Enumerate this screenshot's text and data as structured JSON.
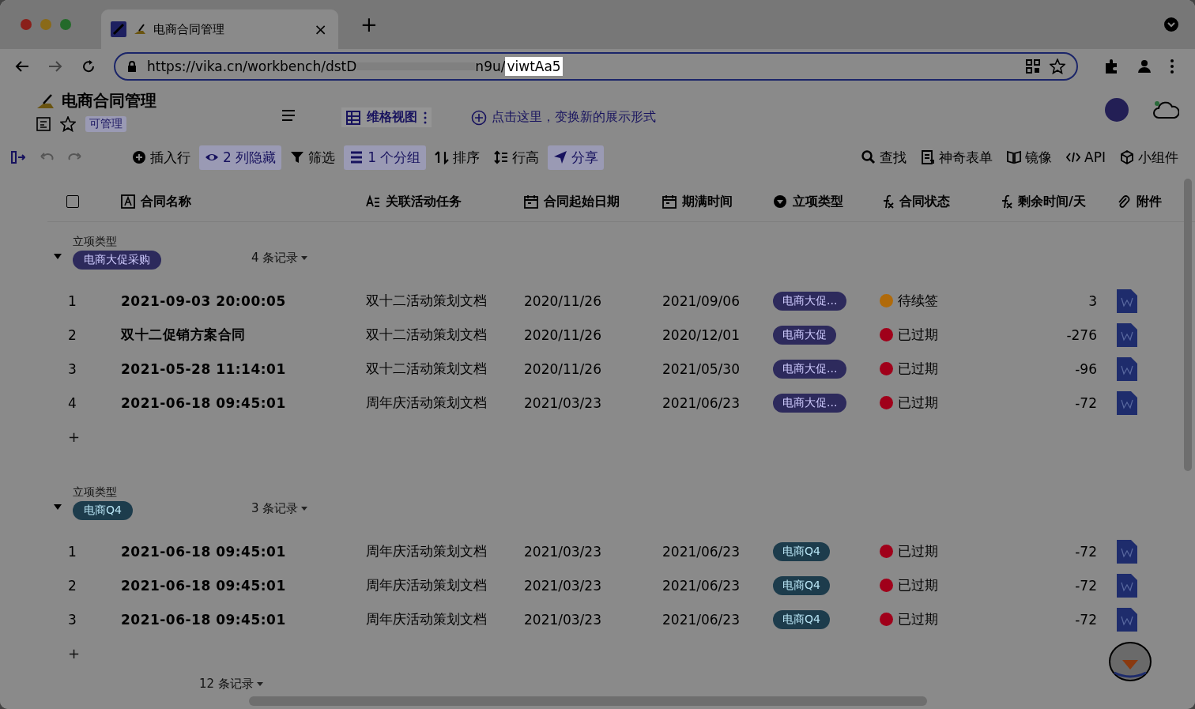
{
  "browser": {
    "tab": {
      "title": "电商合同管理",
      "close": "×"
    },
    "new_tab": "+",
    "url": {
      "prefix": "https://vika.cn/workbench/dstD",
      "middle": "n9u/",
      "selected": "viwtAa5"
    }
  },
  "header": {
    "title": "电商合同管理",
    "permission": "可管理",
    "view_tab": "维格视图",
    "add_view_hint": "点击这里，变换新的展示形式"
  },
  "toolbar": {
    "left": [
      {
        "label": "插入行",
        "accent": false
      },
      {
        "label": "2 列隐藏",
        "accent": true
      },
      {
        "label": "筛选",
        "accent": false
      },
      {
        "label": "1 个分组",
        "accent": true
      },
      {
        "label": "排序",
        "accent": false
      },
      {
        "label": "行高",
        "accent": false
      },
      {
        "label": "分享",
        "accent": true
      }
    ],
    "right": [
      {
        "label": "查找"
      },
      {
        "label": "神奇表单"
      },
      {
        "label": "镜像"
      },
      {
        "label": "API"
      },
      {
        "label": "小组件"
      }
    ]
  },
  "select_all": {
    "checked": false
  },
  "columns": [
    {
      "label": "合同名称"
    },
    {
      "label": "关联活动任务"
    },
    {
      "label": "合同起始日期"
    },
    {
      "label": "期满时间"
    },
    {
      "label": "立项类型"
    },
    {
      "label": "合同状态"
    },
    {
      "label": "剩余时间/天"
    },
    {
      "label": "附件"
    }
  ],
  "groups": [
    {
      "field": "立项类型",
      "tag": "电商大促采购",
      "color": "#2d2a5c",
      "count": "4 条记录",
      "add": "+",
      "rows": [
        {
          "number": "1",
          "name": "2021-09-03 20:00:05",
          "task": "双十二活动策划文档",
          "start": "2020/11/26",
          "end": "2021/09/06",
          "type": "电商大促...",
          "status": "待续签",
          "color": "#b06a0a",
          "remaining": "3"
        },
        {
          "number": "2",
          "name": "双十二促销方案合同",
          "task": "双十二活动策划文档",
          "start": "2020/11/26",
          "end": "2020/12/01",
          "type": "电商大促",
          "status": "已过期",
          "color": "#a0001a",
          "remaining": "-276"
        },
        {
          "number": "3",
          "name": "2021-05-28 11:14:01",
          "task": "双十二活动策划文档",
          "start": "2020/11/26",
          "end": "2021/05/30",
          "type": "电商大促...",
          "status": "已过期",
          "color": "#a0001a",
          "remaining": "-96"
        },
        {
          "number": "4",
          "name": "2021-06-18 09:45:01",
          "task": "周年庆活动策划文档",
          "start": "2021/03/23",
          "end": "2021/06/23",
          "type": "电商大促...",
          "status": "已过期",
          "color": "#a0001a",
          "remaining": "-72"
        }
      ]
    },
    {
      "field": "立项类型",
      "tag": "电商Q4",
      "color": "#1d3c4c",
      "count": "3 条记录",
      "add": "+",
      "rows": [
        {
          "number": "1",
          "name": "2021-06-18 09:45:01",
          "task": "周年庆活动策划文档",
          "start": "2021/03/23",
          "end": "2021/06/23",
          "type": "电商Q4",
          "status": "已过期",
          "color": "#a0001a",
          "remaining": "-72"
        },
        {
          "number": "2",
          "name": "2021-06-18 09:45:01",
          "task": "周年庆活动策划文档",
          "start": "2021/03/23",
          "end": "2021/06/23",
          "type": "电商Q4",
          "status": "已过期",
          "color": "#a0001a",
          "remaining": "-72"
        },
        {
          "number": "3",
          "name": "2021-06-18 09:45:01",
          "task": "周年庆活动策划文档",
          "start": "2021/03/23",
          "end": "2021/06/23",
          "type": "电商Q4",
          "status": "已过期",
          "color": "#a0001a",
          "remaining": "-72"
        }
      ]
    }
  ],
  "footer": {
    "total": "12 条记录"
  }
}
